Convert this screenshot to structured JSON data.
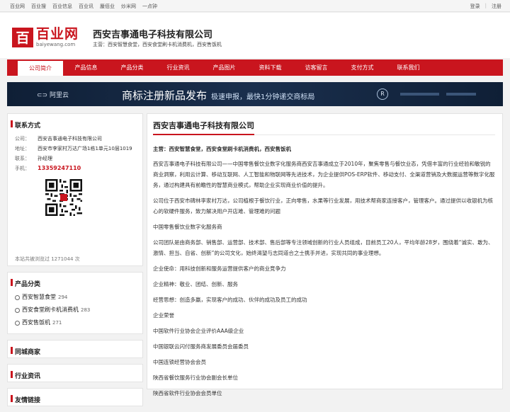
{
  "topbar": {
    "links": [
      "百业网",
      "百业搜",
      "百业信息",
      "百业讯",
      "蜃佰业",
      "炒米网",
      "一点钟"
    ],
    "login": "登录",
    "register": "注册"
  },
  "logo": {
    "name": "百业网",
    "domain": "baiyewang.com",
    "mark": "百"
  },
  "company": {
    "name": "西安吉事通电子科技有限公司",
    "main_business": "主营：西安智慧食堂，西安食堂刷卡机消费机，西安售饭机"
  },
  "nav": [
    "公司简介",
    "产品信息",
    "产品分类",
    "行业资讯",
    "产品图片",
    "资料下载",
    "访客留言",
    "支付方式",
    "联系我们"
  ],
  "banner": {
    "brand": "阿里云",
    "main": "商标注册新品发布",
    "sub": "极速申报，最快1分钟递交商标局",
    "badge": "R"
  },
  "contact": {
    "title": "联系方式",
    "rows": [
      {
        "k": "公司：",
        "v": "西安吉事通电子科技有限公司"
      },
      {
        "k": "地址：",
        "v": "西安市李家村万达广场1栋1单元10层1019"
      },
      {
        "k": "联系：",
        "v": "孙经理"
      },
      {
        "k": "手机：",
        "v": "13359247110"
      }
    ],
    "visits": "本站共被浏览过 1271044 次"
  },
  "categories": {
    "title": "产品分类",
    "items": [
      {
        "name": "西安智慧食堂",
        "count": "294"
      },
      {
        "name": "西安食堂刷卡机消费机",
        "count": "283"
      },
      {
        "name": "西安售饭机",
        "count": "271"
      }
    ]
  },
  "local_business": {
    "title": "同城商家"
  },
  "industry_news": {
    "title": "行业资讯"
  },
  "friend_links": {
    "title": "友情链接"
  },
  "article": {
    "title": "西安吉事通电子科技有限公司",
    "lead": "主营：西安智慧食堂，西安食堂刷卡机消费机，西安售饭机",
    "p1": "西安吉事通电子科技有限公司——中国零售餐饮业数字化服务商西安吉事通成立于2010年，聚焦零售与餐饮业态，凭借丰富的行业经验和敏锐的商业洞察，利用云计算、移动互联网、人工智能和物联网等先进技术，为企业提供POS-ERP软件、移动支付、全渠道营销及大数据运营等数字化服务，通过构建具有前瞻性的智慧商业模式，帮助企业实现商业价值的提升。",
    "p2": "公司位于西安市碑林李家村万达，公司植根于餐饮行业，正向零售，水果等行业发展，用技术帮商家连接客户，管理客户。通过提供以收银机为核心的软硬件服务，致力解决用户开店难、管理难的问题",
    "p3": "中国零售餐饮业数字化服务商",
    "p4": "公司团队是由商务部、销售部、运营部、技术部、售后部等专注领域创新的行业人员组成，目前员工20人，平均年龄28岁，围绕着“诚实、敢为、激情、担当、自省、创新”的公司文化，始终渴望与志同道合之士携手并进，实现共同的事业理想。",
    "p5": "企业使命：用科技创新和服务运营提供客户的商业竞争力",
    "p6": "企业精神：敬业、团结、创新、服务",
    "p7": "经营思想：创造多赢，实现客户的成功、伙伴的成功及员工的成功",
    "p8": "企业荣誉",
    "p9": "中国软件行业协会企业评价AAA级企业",
    "p10": "中国银联云闪付服务商发展委员会届委员",
    "p11": "中国连锁经营协会会员",
    "p12": "陕西省餐饮服务行业协会副会长单位",
    "p13": "陕西省软件行业协会会员单位"
  },
  "colors": {
    "brand": "#c9151e",
    "phone": "#c9151e"
  }
}
